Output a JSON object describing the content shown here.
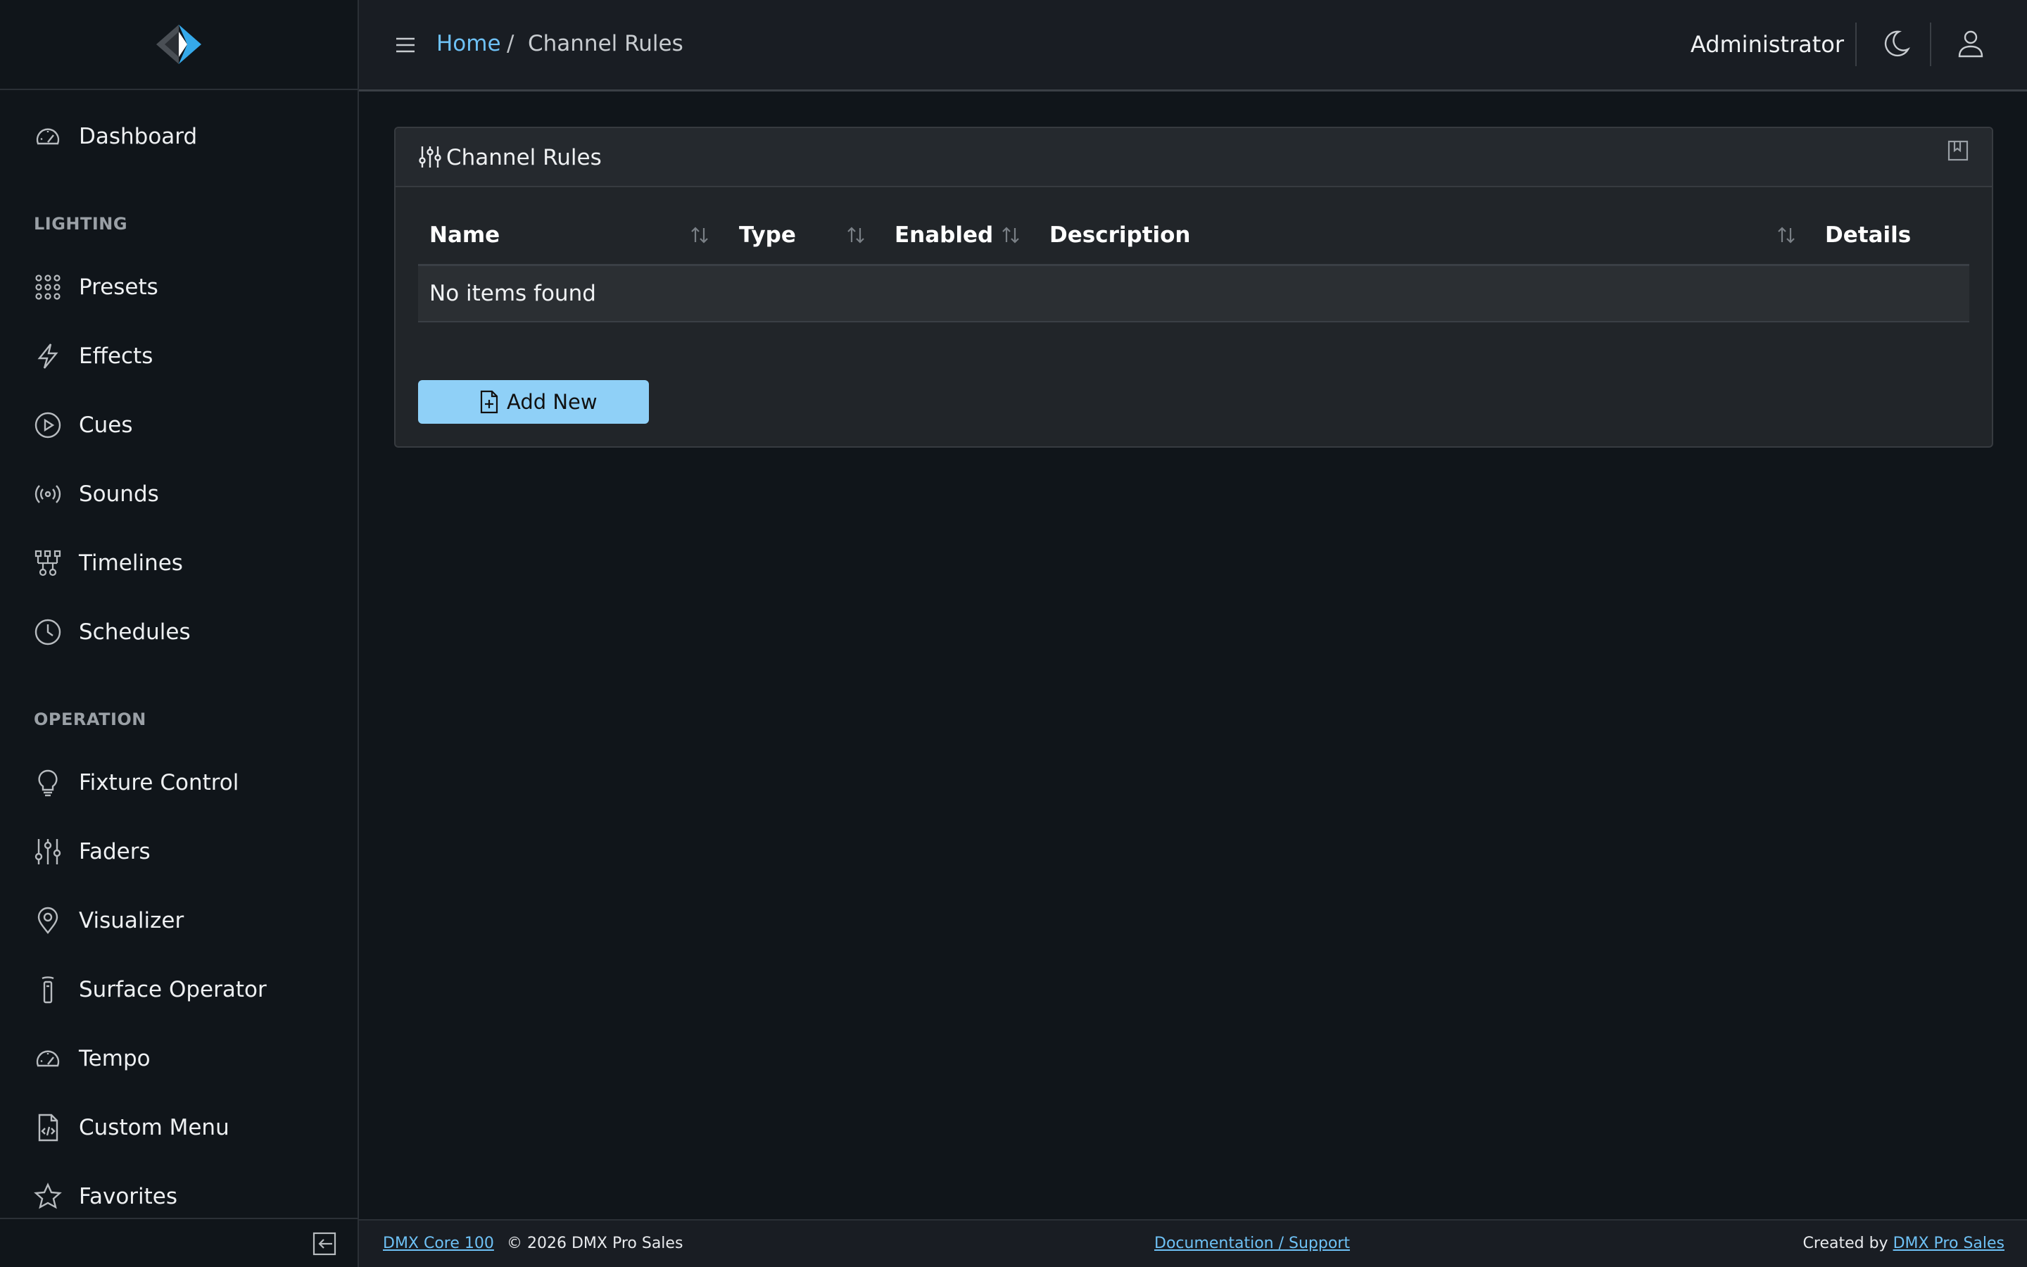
{
  "header": {
    "breadcrumb_home": "Home",
    "breadcrumb_sep": "/",
    "breadcrumb_current": "Channel Rules",
    "user_name": "Administrator",
    "icons": [
      "menu-icon",
      "moon-icon",
      "user-icon"
    ]
  },
  "sidebar": {
    "top_item": {
      "label": "Dashboard",
      "icon": "speedometer-icon"
    },
    "sections": [
      {
        "label": "LIGHTING",
        "items": [
          {
            "label": "Presets",
            "icon": "grid-dots-icon"
          },
          {
            "label": "Effects",
            "icon": "lightning-icon"
          },
          {
            "label": "Cues",
            "icon": "play-circle-icon"
          },
          {
            "label": "Sounds",
            "icon": "broadcast-icon"
          },
          {
            "label": "Timelines",
            "icon": "diagram-icon"
          },
          {
            "label": "Schedules",
            "icon": "clock-icon"
          }
        ]
      },
      {
        "label": "OPERATION",
        "items": [
          {
            "label": "Fixture Control",
            "icon": "lightbulb-icon"
          },
          {
            "label": "Faders",
            "icon": "sliders-icon"
          },
          {
            "label": "Visualizer",
            "icon": "map-pin-icon"
          },
          {
            "label": "Surface Operator",
            "icon": "remote-icon"
          },
          {
            "label": "Tempo",
            "icon": "speedometer-icon"
          },
          {
            "label": "Custom Menu",
            "icon": "file-code-icon"
          },
          {
            "label": "Favorites",
            "icon": "star-icon"
          }
        ]
      }
    ]
  },
  "card": {
    "title": "Channel Rules",
    "columns": [
      "Name",
      "Type",
      "Enabled",
      "Description",
      "Details"
    ],
    "empty_message": "No items found",
    "add_button_label": "Add New"
  },
  "footer": {
    "product_link": "DMX Core 100",
    "copyright": "© 2026 DMX Pro Sales",
    "docs_link": "Documentation / Support",
    "created_by": "Created by",
    "company_link": "DMX Pro Sales"
  },
  "colors": {
    "accent": "#6ec1f5",
    "button_bg": "#8fd0f7",
    "page_bg": "#10151a",
    "card_bg": "#212529"
  }
}
